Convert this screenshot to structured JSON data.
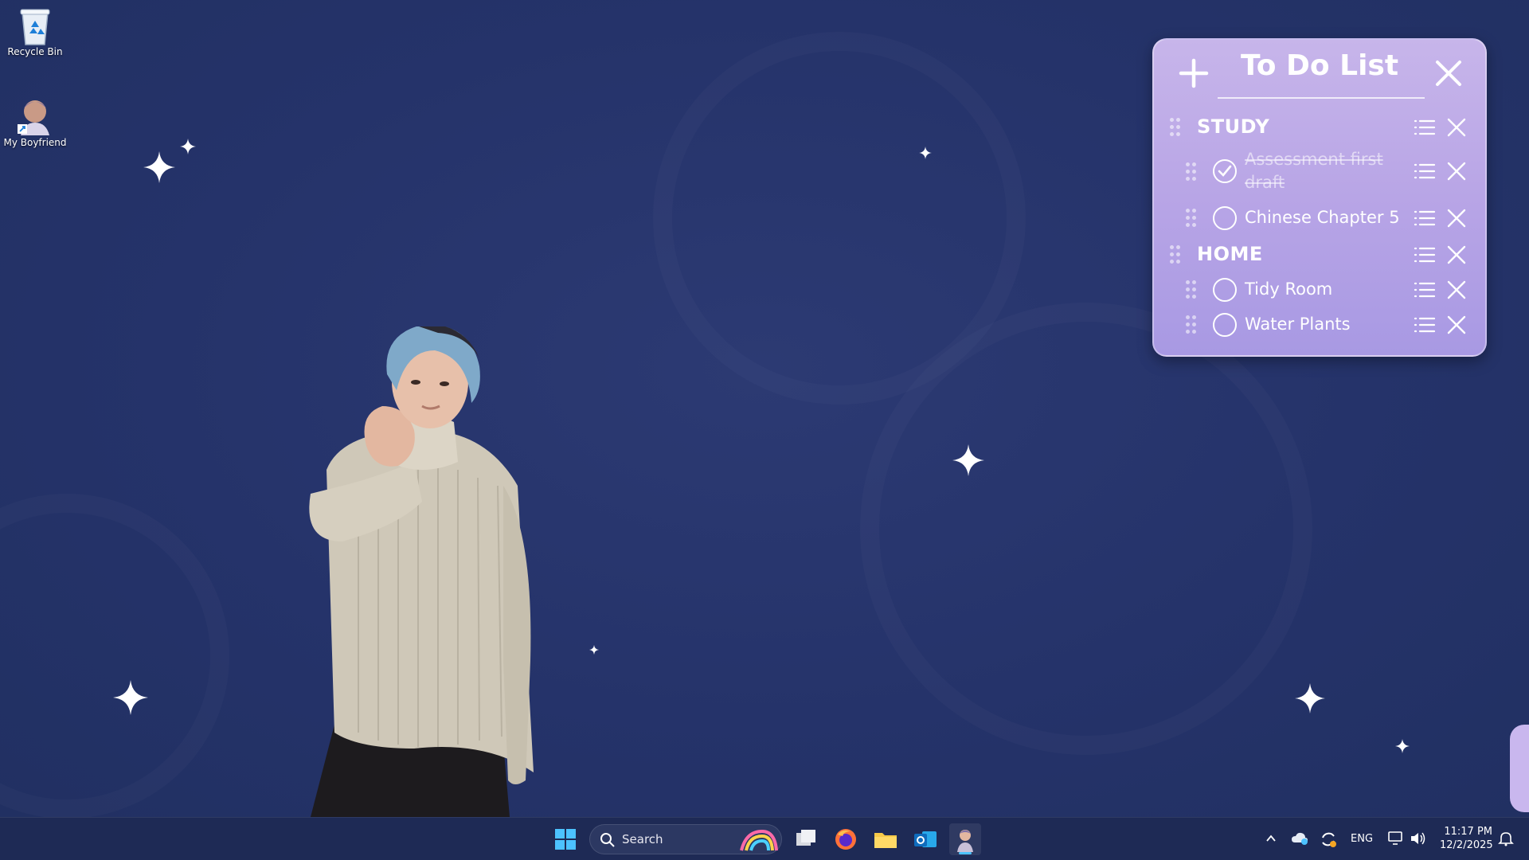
{
  "desktop": {
    "icons": [
      {
        "label": "Recycle Bin",
        "icon": "recycle-bin-icon"
      },
      {
        "label": "My Boyfriend",
        "icon": "app-shortcut-icon"
      }
    ]
  },
  "todo": {
    "title": "To Do List",
    "categories": [
      {
        "name": "STUDY",
        "tasks": [
          {
            "label": "Assessment first draft",
            "done": true
          },
          {
            "label": "Chinese Chapter 5",
            "done": false
          }
        ]
      },
      {
        "name": "HOME",
        "tasks": [
          {
            "label": "Tidy Room",
            "done": false
          },
          {
            "label": "Water Plants",
            "done": false
          }
        ]
      }
    ]
  },
  "taskbar": {
    "search_placeholder": "Search",
    "apps": [
      "start-icon",
      "task-view-icon",
      "firefox-icon",
      "file-explorer-icon",
      "outlook-icon",
      "my-boyfriend-app-icon"
    ],
    "tray": {
      "language": "ENG",
      "time": "11:17 PM",
      "date": "12/2/2025"
    }
  },
  "colors": {
    "desktop_bg": "#25336a",
    "widget_bg": "#b8a5e6",
    "taskbar_bg": "#1e2a55"
  }
}
